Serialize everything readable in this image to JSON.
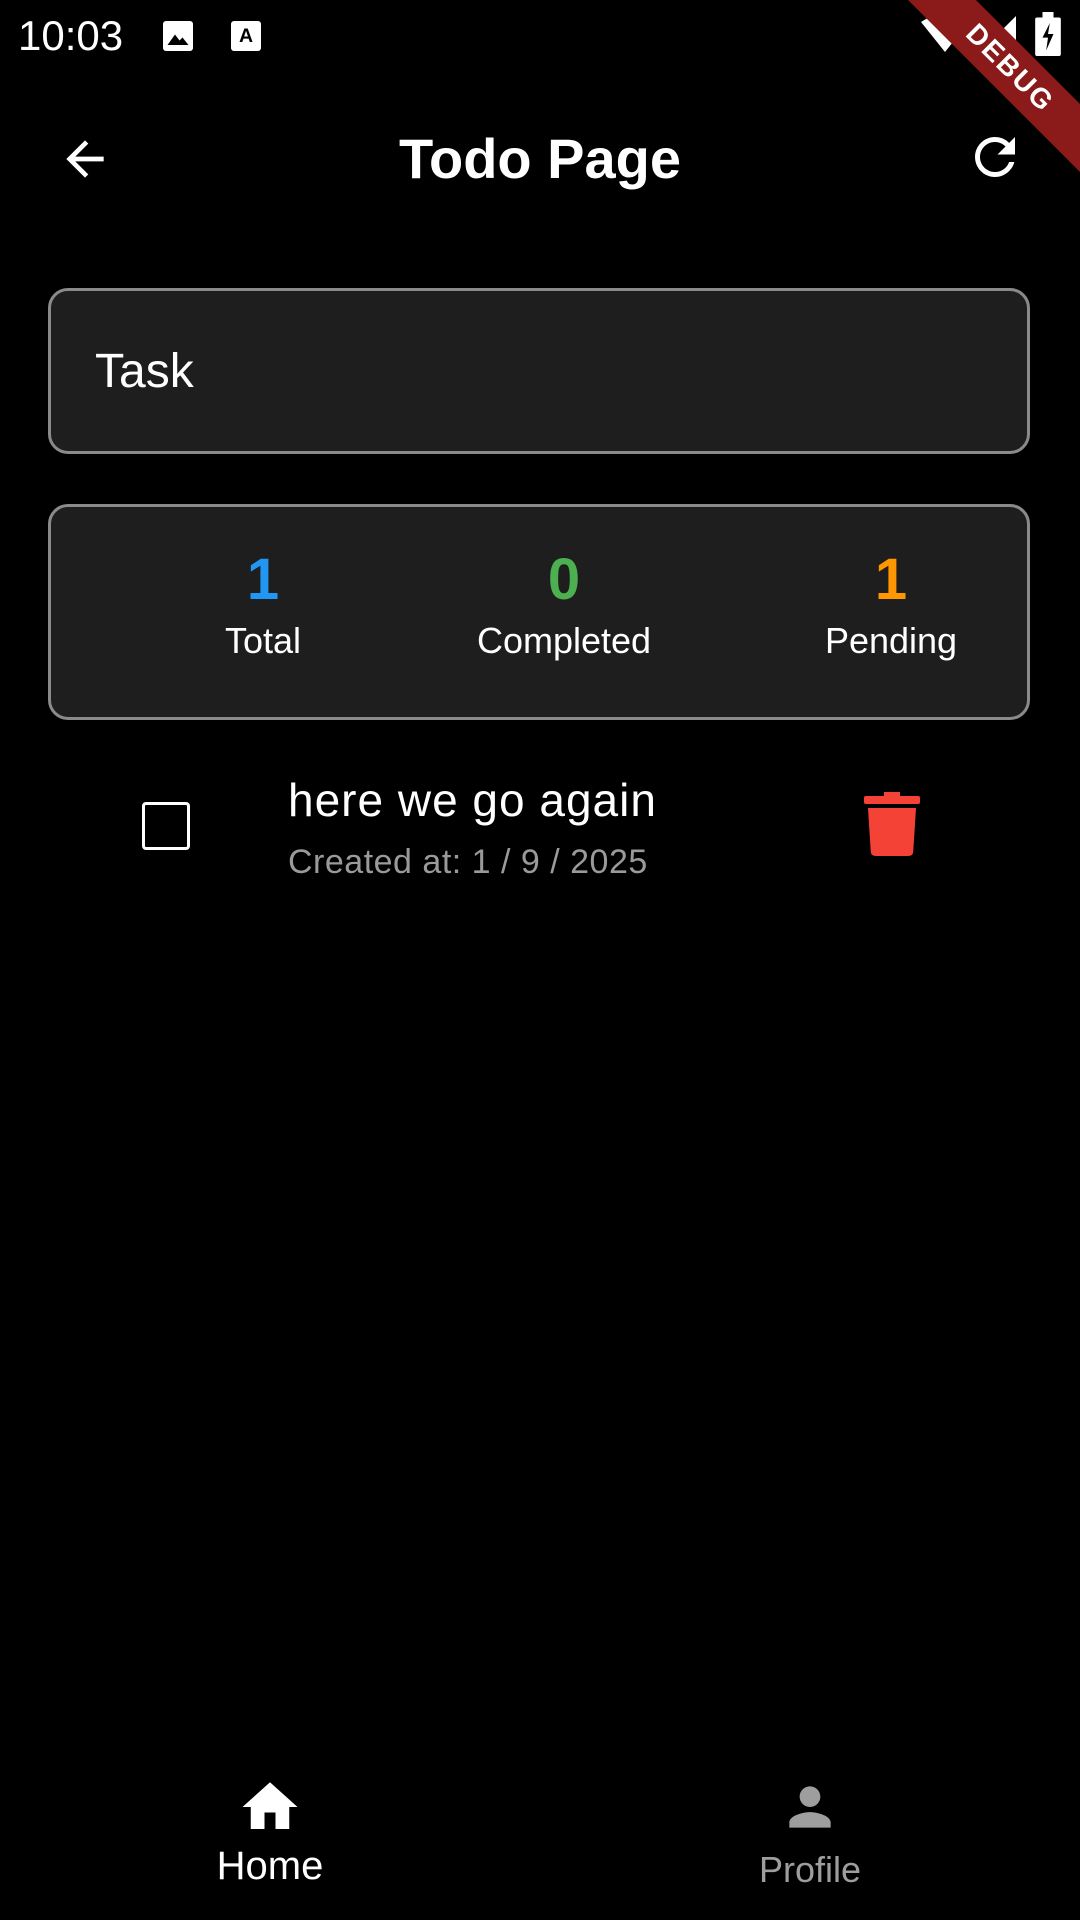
{
  "status_bar": {
    "time": "10:03",
    "icons": [
      "image-icon",
      "keyboard-icon",
      "wifi-icon",
      "signal-icon",
      "battery-charging-icon"
    ]
  },
  "debug_banner": "DEBUG",
  "app_bar": {
    "title": "Todo Page",
    "back_icon": "arrow-back-icon",
    "refresh_icon": "refresh-icon"
  },
  "task_input": {
    "placeholder": "Task",
    "value": ""
  },
  "stats": {
    "total": {
      "value": "1",
      "label": "Total",
      "color": "#2196f3"
    },
    "completed": {
      "value": "0",
      "label": "Completed",
      "color": "#4caf50"
    },
    "pending": {
      "value": "1",
      "label": "Pending",
      "color": "#ff9800"
    }
  },
  "todos": [
    {
      "title": "here we go again",
      "created": "Created at: 1 / 9 / 2025",
      "checked": false,
      "delete_color": "#f44336"
    }
  ],
  "bottom_nav": {
    "items": [
      {
        "label": "Home",
        "icon": "home-icon",
        "active": true
      },
      {
        "label": "Profile",
        "icon": "person-icon",
        "active": false
      }
    ],
    "active_color": "#ffffff",
    "inactive_color": "#9e9e9e"
  }
}
